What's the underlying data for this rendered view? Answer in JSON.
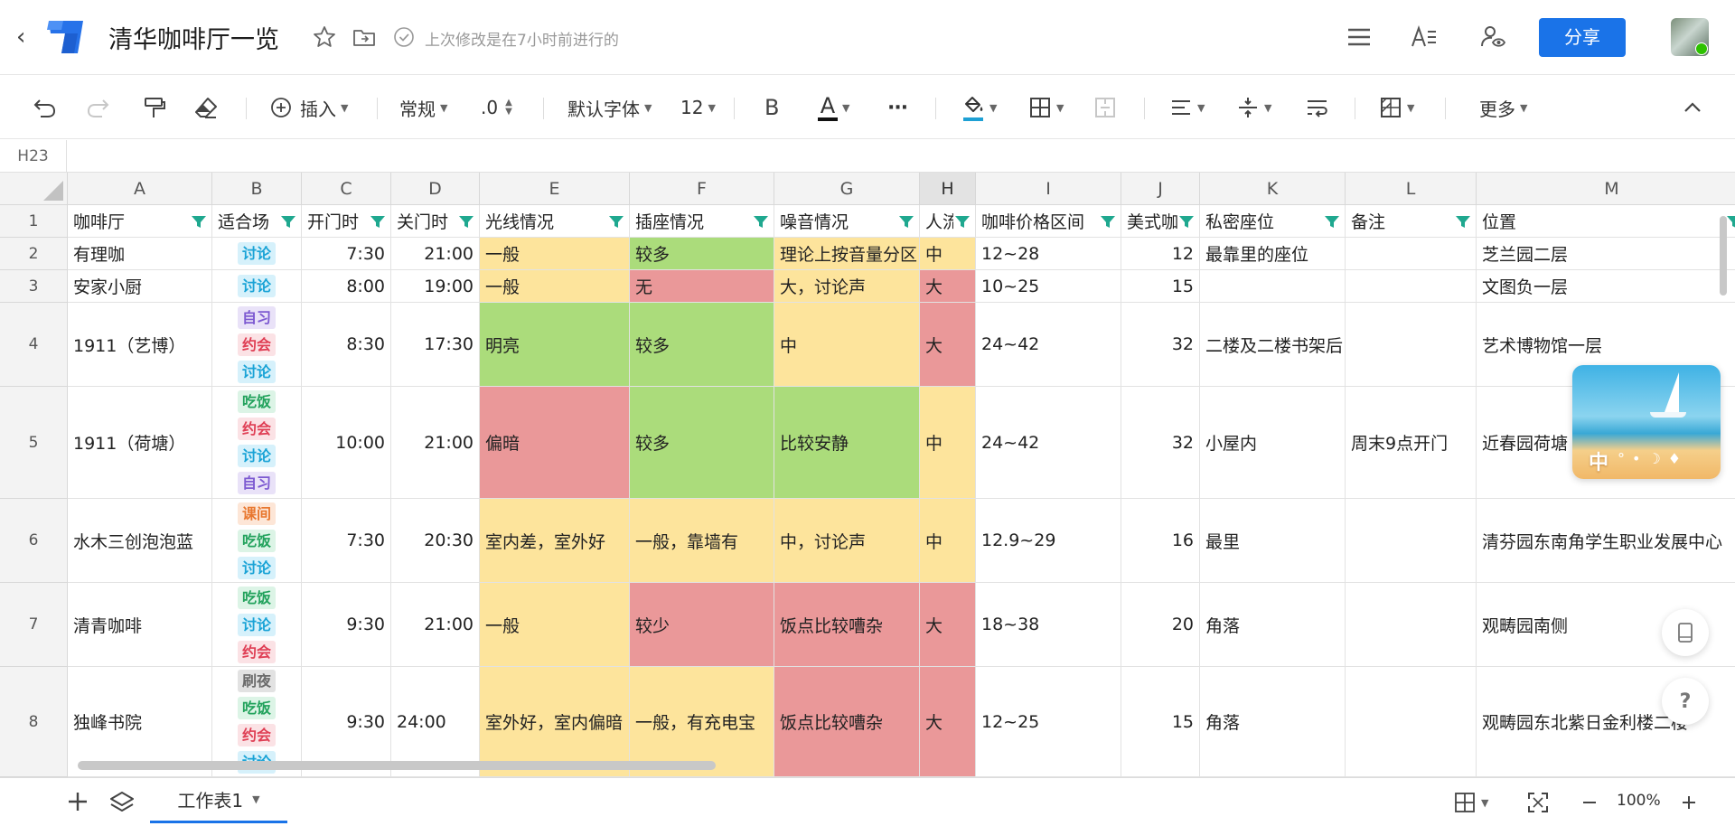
{
  "header": {
    "title": "清华咖啡厅一览",
    "save_status": "上次修改是在7小时前进行的",
    "share_label": "分享"
  },
  "toolbar": {
    "insert_label": "插入",
    "format_label": "常规",
    "decimal_label": ".0",
    "font_label": "默认字体",
    "size_label": "12",
    "bold_label": "B",
    "text_color_label": "A",
    "more_dots": "···",
    "more_label": "更多",
    "accent_color": "#1a73e8",
    "fill_underline_color": "#1ea0d4"
  },
  "formula": {
    "cell_ref": "H23"
  },
  "grid": {
    "columns": [
      "A",
      "B",
      "C",
      "D",
      "E",
      "F",
      "G",
      "H",
      "I",
      "J",
      "K",
      "L",
      "M"
    ],
    "selected_column": "H",
    "row_numbers": [
      "1",
      "2",
      "3",
      "4",
      "5",
      "6",
      "7",
      "8"
    ],
    "header_row": [
      "咖啡厅",
      "适合场",
      "开门时",
      "关门时",
      "光线情况",
      "插座情况",
      "噪音情况",
      "人流",
      "咖啡价格区间",
      "美式咖",
      "私密座位",
      "备注",
      "位置"
    ],
    "rows": [
      {
        "cafe": "有理咖",
        "tags": [
          "讨论"
        ],
        "open": "7:30",
        "close": "21:00",
        "light": "一般",
        "light_color": "yellow",
        "socket": "较多",
        "socket_color": "green",
        "noise": "理论上按音量分区",
        "noise_color": "yellow",
        "crowd": "中",
        "crowd_color": "yellow",
        "price": "12~28",
        "americano": "12",
        "private": "最靠里的座位",
        "note": "",
        "location": "芝兰园二层"
      },
      {
        "cafe": "安家小厨",
        "tags": [
          "讨论"
        ],
        "open": "8:00",
        "close": "19:00",
        "light": "一般",
        "light_color": "yellow",
        "socket": "无",
        "socket_color": "red",
        "noise": "大，讨论声",
        "noise_color": "yellow",
        "crowd": "大",
        "crowd_color": "red",
        "price": "10~25",
        "americano": "15",
        "private": "",
        "note": "",
        "location": "文图负一层"
      },
      {
        "cafe": "1911（艺博）",
        "tags": [
          "自习",
          "约会",
          "讨论"
        ],
        "open": "8:30",
        "close": "17:30",
        "light": "明亮",
        "light_color": "green",
        "socket": "较多",
        "socket_color": "green",
        "noise": "中",
        "noise_color": "yellow",
        "crowd": "大",
        "crowd_color": "red",
        "price": "24~42",
        "americano": "32",
        "private": "二楼及二楼书架后",
        "note": "",
        "location": "艺术博物馆一层"
      },
      {
        "cafe": "1911（荷塘）",
        "tags": [
          "吃饭",
          "约会",
          "讨论",
          "自习"
        ],
        "open": "10:00",
        "close": "21:00",
        "light": "偏暗",
        "light_color": "red",
        "socket": "较多",
        "socket_color": "green",
        "noise": "比较安静",
        "noise_color": "green",
        "crowd": "中",
        "crowd_color": "yellow",
        "price": "24~42",
        "americano": "32",
        "private": "小屋内",
        "note": "周末9点开门",
        "location": "近春园荷塘"
      },
      {
        "cafe": "水木三创泡泡蓝",
        "tags": [
          "课间",
          "吃饭",
          "讨论"
        ],
        "open": "7:30",
        "close": "20:30",
        "light": "室内差，室外好",
        "light_color": "yellow",
        "socket": "一般，靠墙有",
        "socket_color": "yellow",
        "noise": "中，讨论声",
        "noise_color": "yellow",
        "crowd": "中",
        "crowd_color": "yellow",
        "price": "12.9~29",
        "americano": "16",
        "private": "最里",
        "note": "",
        "location": "清芬园东南角学生职业发展中心"
      },
      {
        "cafe": "清青咖啡",
        "tags": [
          "吃饭",
          "讨论",
          "约会"
        ],
        "open": "9:30",
        "close": "21:00",
        "light": "一般",
        "light_color": "yellow",
        "socket": "较少",
        "socket_color": "red",
        "noise": "饭点比较嘈杂",
        "noise_color": "red",
        "crowd": "大",
        "crowd_color": "red",
        "price": "18~38",
        "americano": "20",
        "private": "角落",
        "note": "",
        "location": "观畴园南侧"
      },
      {
        "cafe": "独峰书院",
        "tags": [
          "刷夜",
          "吃饭",
          "约会",
          "讨论"
        ],
        "open": "9:30",
        "close": "24:00",
        "light": "室外好，室内偏暗",
        "light_color": "yellow",
        "socket": "一般，有充电宝",
        "socket_color": "yellow",
        "noise": "饭点比较嘈杂",
        "noise_color": "red",
        "crowd": "大",
        "crowd_color": "red",
        "price": "12~25",
        "americano": "15",
        "private": "角落",
        "note": "",
        "location": "观畴园东北紫日金利楼二楼"
      }
    ]
  },
  "float_card": {
    "mode_text": "中"
  },
  "help_label": "?",
  "bottom": {
    "sheet_tab": "工作表1",
    "zoom": "100%"
  }
}
